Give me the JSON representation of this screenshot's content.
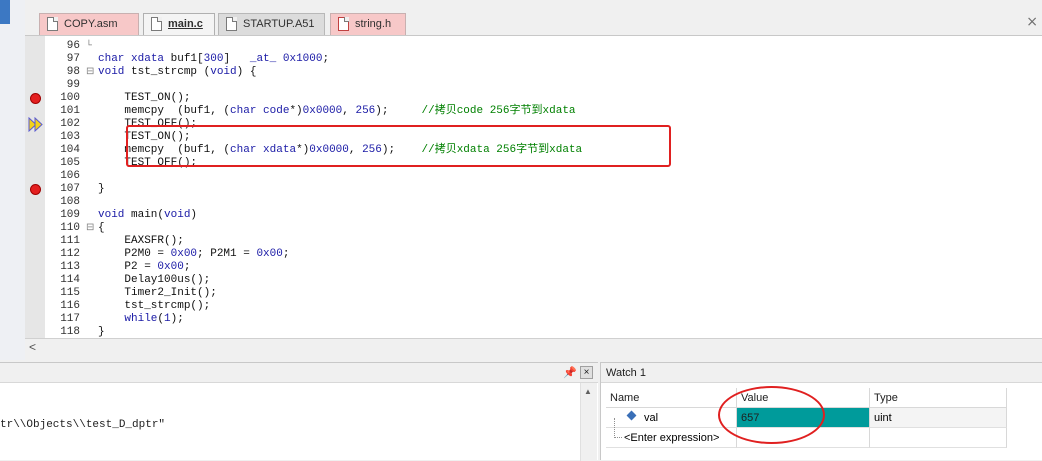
{
  "tabs": [
    {
      "label": "COPY.asm"
    },
    {
      "label": "main.c"
    },
    {
      "label": "STARTUP.A51"
    },
    {
      "label": "string.h"
    }
  ],
  "editor": {
    "lines": [
      {
        "num": "96",
        "fold": "└",
        "code": ""
      },
      {
        "num": "97",
        "fold": "",
        "code": "char xdata buf1[300]   _at_ 0x1000;"
      },
      {
        "num": "98",
        "fold": "⊟",
        "code": "void tst_strcmp (void) {"
      },
      {
        "num": "99",
        "fold": "",
        "code": ""
      },
      {
        "num": "100",
        "fold": "",
        "code": "    TEST_ON();"
      },
      {
        "num": "101",
        "fold": "",
        "code": "    memcpy  (buf1, (char code*)0x0000, 256);     //拷贝code 256字节到xdata"
      },
      {
        "num": "102",
        "fold": "",
        "code": "    TEST_OFF();"
      },
      {
        "num": "103",
        "fold": "",
        "code": "    TEST_ON();"
      },
      {
        "num": "104",
        "fold": "",
        "code": "    memcpy  (buf1, (char xdata*)0x0000, 256);    //拷贝xdata 256字节到xdata"
      },
      {
        "num": "105",
        "fold": "",
        "code": "    TEST_OFF();"
      },
      {
        "num": "106",
        "fold": "",
        "code": ""
      },
      {
        "num": "107",
        "fold": "",
        "code": "}"
      },
      {
        "num": "108",
        "fold": "",
        "code": ""
      },
      {
        "num": "109",
        "fold": "",
        "code": "void main(void)"
      },
      {
        "num": "110",
        "fold": "⊟",
        "code": "{"
      },
      {
        "num": "111",
        "fold": "",
        "code": "    EAXSFR();"
      },
      {
        "num": "112",
        "fold": "",
        "code": "    P2M0 = 0x00; P2M1 = 0x00;"
      },
      {
        "num": "113",
        "fold": "",
        "code": "    P2 = 0x00;"
      },
      {
        "num": "114",
        "fold": "",
        "code": "    Delay100us();"
      },
      {
        "num": "115",
        "fold": "",
        "code": "    Timer2_Init();"
      },
      {
        "num": "116",
        "fold": "",
        "code": "    tst_strcmp();"
      },
      {
        "num": "117",
        "fold": "",
        "code": "    while(1);"
      },
      {
        "num": "118",
        "fold": "",
        "code": "}"
      }
    ]
  },
  "console": {
    "text": "tr\\\\Objects\\\\test_D_dptr\""
  },
  "watch": {
    "title": "Watch 1",
    "columns": {
      "name": "Name",
      "value": "Value",
      "type": "Type"
    },
    "rows": [
      {
        "name": "val",
        "value": "657",
        "type": "uint"
      }
    ],
    "enter_expression": "<Enter expression>"
  },
  "colors": {
    "breakpoint": "#e41f1f",
    "value_highlight": "#009b9b",
    "annotation": "#e02020"
  }
}
